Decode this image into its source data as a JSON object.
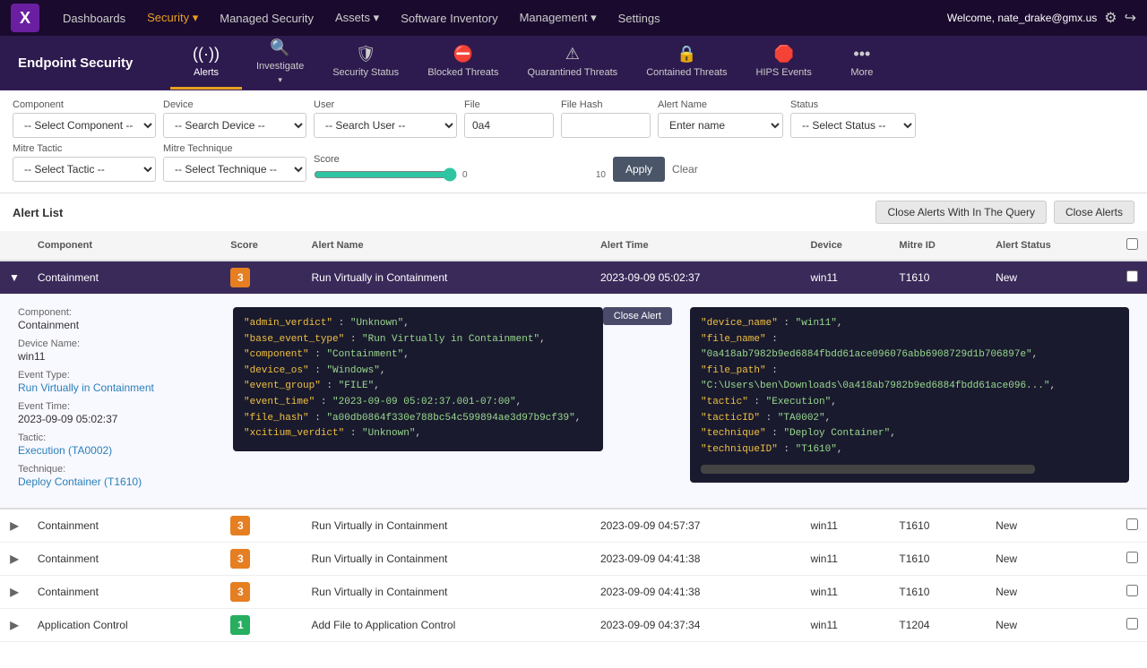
{
  "topnav": {
    "logo_text": "✕",
    "items": [
      {
        "label": "Dashboards",
        "active": false
      },
      {
        "label": "Security",
        "active": true,
        "has_chevron": true
      },
      {
        "label": "Managed Security",
        "active": false
      },
      {
        "label": "Assets",
        "active": false,
        "has_chevron": true
      },
      {
        "label": "Software Inventory",
        "active": false
      },
      {
        "label": "Management",
        "active": false,
        "has_chevron": true
      },
      {
        "label": "Settings",
        "active": false
      }
    ],
    "user": "Welcome, nate_drake@gmx.us"
  },
  "secnav": {
    "title": "Endpoint Security",
    "items": [
      {
        "icon": "📡",
        "label": "Alerts",
        "active": true
      },
      {
        "icon": "🔍",
        "label": "Investigate",
        "active": false,
        "has_chevron": true
      },
      {
        "icon": "🛡️",
        "label": "Security Status",
        "active": false
      },
      {
        "icon": "⛔",
        "label": "Blocked Threats",
        "active": false
      },
      {
        "icon": "⚠️",
        "label": "Quarantined Threats",
        "active": false
      },
      {
        "icon": "🔒",
        "label": "Contained Threats",
        "active": false
      },
      {
        "icon": "🛑",
        "label": "HIPS Events",
        "active": false
      },
      {
        "icon": "•••",
        "label": "More",
        "active": false
      }
    ]
  },
  "filters": {
    "component_label": "Component",
    "component_placeholder": "-- Select Component --",
    "device_label": "Device",
    "device_placeholder": "-- Search Device --",
    "user_label": "User",
    "user_placeholder": "-- Search User --",
    "file_label": "File",
    "file_value": "0a4",
    "file_hash_label": "File Hash",
    "file_hash_value": "",
    "alert_name_label": "Alert Name",
    "alert_name_placeholder": "Enter name",
    "status_label": "Status",
    "status_placeholder": "-- Select Status --",
    "mitre_tactic_label": "Mitre Tactic",
    "mitre_tactic_placeholder": "-- Select Tactic --",
    "mitre_technique_label": "Mitre Technique",
    "mitre_technique_placeholder": "-- Select Technique --",
    "score_label": "Score",
    "score_min": "0",
    "score_max": "10",
    "apply_label": "Apply",
    "clear_label": "Clear"
  },
  "alert_list": {
    "title": "Alert List",
    "close_query_btn": "Close Alerts With In The Query",
    "close_alerts_btn": "Close Alerts",
    "columns": [
      "Component",
      "Score",
      "Alert Name",
      "Alert Time",
      "Device",
      "Mitre ID",
      "Alert Status",
      ""
    ],
    "rows": [
      {
        "id": 1,
        "expanded": true,
        "component": "Containment",
        "score": "3",
        "score_color": "orange",
        "alert_name": "Run Virtually in Containment",
        "alert_time": "2023-09-09 05:02:37",
        "device": "win11",
        "mitre_id": "T1610",
        "alert_status": "New"
      },
      {
        "id": 2,
        "expanded": false,
        "component": "Containment",
        "score": "3",
        "score_color": "orange",
        "alert_name": "Run Virtually in Containment",
        "alert_time": "2023-09-09 04:57:37",
        "device": "win11",
        "mitre_id": "T1610",
        "alert_status": "New"
      },
      {
        "id": 3,
        "expanded": false,
        "component": "Containment",
        "score": "3",
        "score_color": "orange",
        "alert_name": "Run Virtually in Containment",
        "alert_time": "2023-09-09 04:41:38",
        "device": "win11",
        "mitre_id": "T1610",
        "alert_status": "New"
      },
      {
        "id": 4,
        "expanded": false,
        "component": "Containment",
        "score": "3",
        "score_color": "orange",
        "alert_name": "Run Virtually in Containment",
        "alert_time": "2023-09-09 04:41:38",
        "device": "win11",
        "mitre_id": "T1610",
        "alert_status": "New"
      },
      {
        "id": 5,
        "expanded": false,
        "component": "Application Control",
        "score": "1",
        "score_color": "green",
        "alert_name": "Add File to Application Control",
        "alert_time": "2023-09-09 04:37:34",
        "device": "win11",
        "mitre_id": "T1204",
        "alert_status": "New"
      }
    ],
    "detail": {
      "close_btn": "Close Alert",
      "component_label": "Component:",
      "component_val": "Containment",
      "device_label": "Device Name:",
      "device_val": "win11",
      "event_type_label": "Event Type:",
      "event_type_val": "Run Virtually in Containment",
      "event_time_label": "Event Time:",
      "event_time_val": "2023-09-09 05:02:37",
      "tactic_label": "Tactic:",
      "tactic_val": "Execution (TA0002)",
      "technique_label": "Technique:",
      "technique_val": "Deploy Container (T1610)",
      "json_left": [
        {
          "key": "admin_verdict",
          "val": "\"Unknown\""
        },
        {
          "key": "base_event_type",
          "val": "\"Run Virtually in Containment\""
        },
        {
          "key": "component",
          "val": "\"Containment\""
        },
        {
          "key": "device_os",
          "val": "\"Windows\""
        },
        {
          "key": "event_group",
          "val": "\"FILE\""
        },
        {
          "key": "event_time",
          "val": "\"2023-09-09 05:02:37.001-07:00\""
        },
        {
          "key": "file_hash",
          "val": "\"a00db0864f330e788bc54c599894ae3d97b9cf39\""
        },
        {
          "key": "xcitium_verdict",
          "val": "\"Unknown\""
        }
      ],
      "json_right": [
        {
          "key": "device_name",
          "val": "\"win11\""
        },
        {
          "key": "file_name",
          "val": "\"0a418ab7982b9ed6884fbdd61ace096076abb6908729d1b706897e\""
        },
        {
          "key": "file_path",
          "val": "\"C:\\Users\\ben\\Downloads\\0a418ab7982b9ed6884fbdd61ace096...\""
        },
        {
          "key": "tactic",
          "val": "\"Execution\""
        },
        {
          "key": "tacticID",
          "val": "\"TA0002\""
        },
        {
          "key": "technique",
          "val": "\"Deploy Container\""
        },
        {
          "key": "techniqueID",
          "val": "\"T1610\""
        }
      ]
    }
  }
}
